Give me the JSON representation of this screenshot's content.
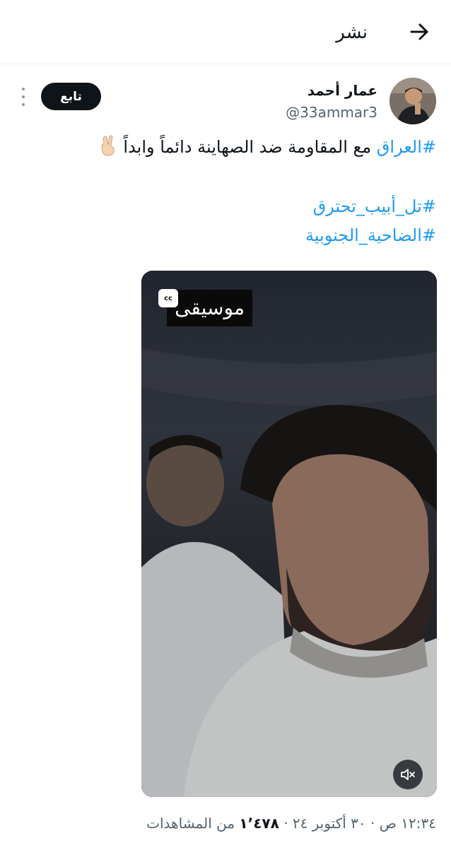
{
  "header": {
    "title": "نشر",
    "back_icon": "arrow-back-icon"
  },
  "author": {
    "name": "عمار أحمد",
    "handle": "@33ammar3",
    "follow_label": "تابع",
    "more_icon": "more-vertical-icon"
  },
  "tweet": {
    "line1_hashtag": "#العراق",
    "line1_text": " مع المقاومة ضد الصهاينة دائماً وابداً",
    "line1_emoji": "victory-hand-emoji",
    "hashtag2": "#تل_أبيب_تحترق",
    "hashtag3": "#الضاحية_الجنوبية",
    "hashtag_color": "#1d9bf0"
  },
  "video": {
    "caption": "موسيقى",
    "cc_label": "cc",
    "mute_icon": "muted-speaker-icon"
  },
  "meta": {
    "time": "١٢:٣٤ ص",
    "separator": " · ",
    "date": "٣٠ أكتوبر ٢٤",
    "views_count": "١٬٤٧٨",
    "views_label": " من المشاهدات"
  }
}
